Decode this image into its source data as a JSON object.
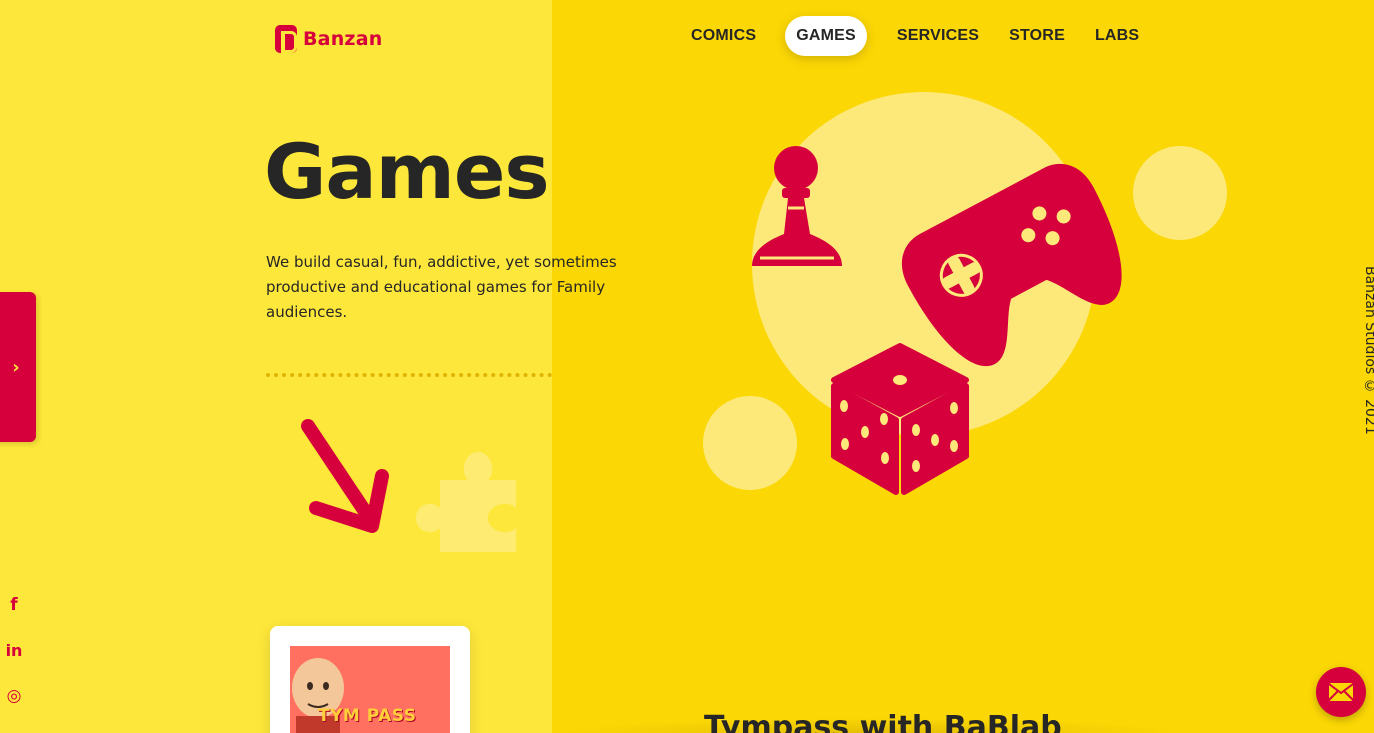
{
  "brand": {
    "name": "Banzan",
    "accent_color": "#d6003c",
    "light_yellow": "#fde73a",
    "deep_yellow": "#fbd705"
  },
  "nav": {
    "items": [
      {
        "label": "COMICS",
        "active": false
      },
      {
        "label": "GAMES",
        "active": true
      },
      {
        "label": "SERVICES",
        "active": false
      },
      {
        "label": "STORE",
        "active": false
      },
      {
        "label": "LABS",
        "active": false
      }
    ]
  },
  "hero": {
    "title": "Games",
    "description": "We build casual, fun, addictive, yet sometimes productive and educational games for Family audiences."
  },
  "side_tab": {
    "icon": "chevron-right-icon"
  },
  "social": [
    {
      "icon": "facebook-icon",
      "glyph": "f"
    },
    {
      "icon": "linkedin-icon",
      "glyph": "in"
    },
    {
      "icon": "instagram-icon",
      "glyph": "◎"
    }
  ],
  "copyright": "Banzan Studios © 2021",
  "featured_game": {
    "thumbnail_text": "TYM PASS",
    "title": "Tympass with BaBlab"
  },
  "contact": {
    "icon": "mail-icon"
  }
}
